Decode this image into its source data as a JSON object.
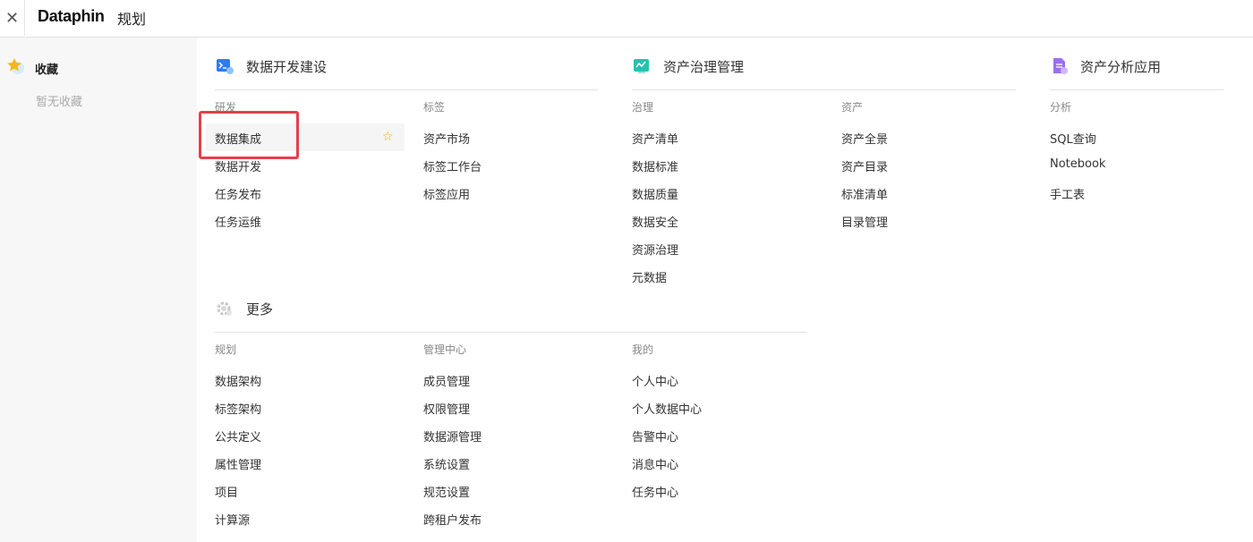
{
  "header": {
    "close_icon": "close-icon",
    "logo": "Dataphin",
    "title": "规划"
  },
  "sidebar": {
    "fav_title": "收藏",
    "fav_empty": "暂无收藏",
    "fav_icon": "star-badge-icon"
  },
  "sections": {
    "dev": {
      "title": "数据开发建设",
      "icon": "terminal-icon",
      "columns": [
        {
          "header": "研发",
          "items": [
            "数据集成",
            "数据开发",
            "任务发布",
            "任务运维"
          ]
        },
        {
          "header": "标签",
          "items": [
            "资产市场",
            "标签工作台",
            "标签应用"
          ]
        }
      ]
    },
    "gov": {
      "title": "资产治理管理",
      "icon": "governance-icon",
      "columns": [
        {
          "header": "治理",
          "items": [
            "资产清单",
            "数据标准",
            "数据质量",
            "数据安全",
            "资源治理",
            "元数据"
          ]
        },
        {
          "header": "资产",
          "items": [
            "资产全景",
            "资产目录",
            "标准清单",
            "目录管理"
          ]
        }
      ]
    },
    "ana": {
      "title": "资产分析应用",
      "icon": "analysis-icon",
      "columns": [
        {
          "header": "分析",
          "items": [
            "SQL查询",
            "Notebook",
            "手工表"
          ]
        }
      ]
    },
    "more": {
      "title": "更多",
      "icon": "gear-icon",
      "columns": [
        {
          "header": "规划",
          "items": [
            "数据架构",
            "标签架构",
            "公共定义",
            "属性管理",
            "项目",
            "计算源"
          ]
        },
        {
          "header": "管理中心",
          "items": [
            "成员管理",
            "权限管理",
            "数据源管理",
            "系统设置",
            "规范设置",
            "跨租户发布"
          ]
        },
        {
          "header": "我的",
          "items": [
            "个人中心",
            "个人数据中心",
            "告警中心",
            "消息中心",
            "任务中心"
          ]
        }
      ]
    }
  },
  "colors": {
    "accent": "#1677ff",
    "highlight_border": "#e5404a",
    "star": "#f2a61f"
  }
}
